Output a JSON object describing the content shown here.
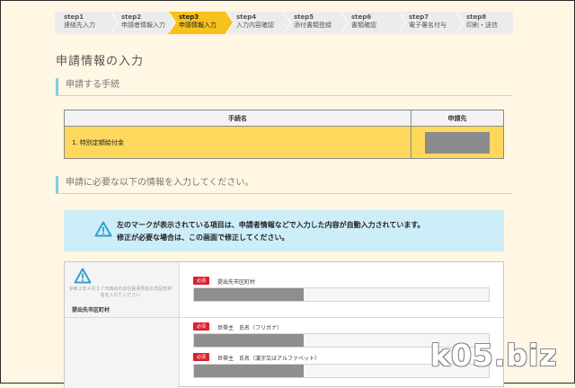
{
  "steps": [
    {
      "num": "step1",
      "label": "連絡先入力"
    },
    {
      "num": "step2",
      "label": "申請者情報入力"
    },
    {
      "num": "step3",
      "label": "申請情報入力"
    },
    {
      "num": "step4",
      "label": "入力内容確認"
    },
    {
      "num": "step5",
      "label": "添付書類登録"
    },
    {
      "num": "step6",
      "label": "書類確認"
    },
    {
      "num": "step7",
      "label": "電子署名付与"
    },
    {
      "num": "step8",
      "label": "印刷・送信"
    }
  ],
  "active_step": 3,
  "page_title": "申請情報の入力",
  "section1": {
    "title": "申請する手続"
  },
  "proc_table": {
    "header_name": "手続名",
    "header_dest": "申請先",
    "row_name": "1. 特別定額給付金"
  },
  "section2": {
    "title": "申請に必要な以下の情報を入力してください。"
  },
  "notice": {
    "line1": "左のマークが表示されている項目は、申請者情報などで入力した内容が自動入力されています。",
    "line2": "修正が必要な場合は、この画面で修正してください。"
  },
  "form": {
    "row1": {
      "note": "令和２年４月２７日時点のお住民票所在の市区町村名を入れてください",
      "label": "提出先市区町村",
      "required": "必須",
      "field_label": "提出先市区町村"
    },
    "row2": {
      "required": "必須",
      "field1_label": "世帯主　氏名（フリガナ）",
      "field2_label": "世帯主　氏名（漢字又はアルファベット）"
    }
  },
  "watermark": "k05.biz",
  "colors": {
    "active_step": "#f7c21b",
    "accent_border": "#7dcfe9",
    "notice_bg": "#cdeef9",
    "required_badge": "#d9212c",
    "highlight_row": "#fdd85d"
  }
}
